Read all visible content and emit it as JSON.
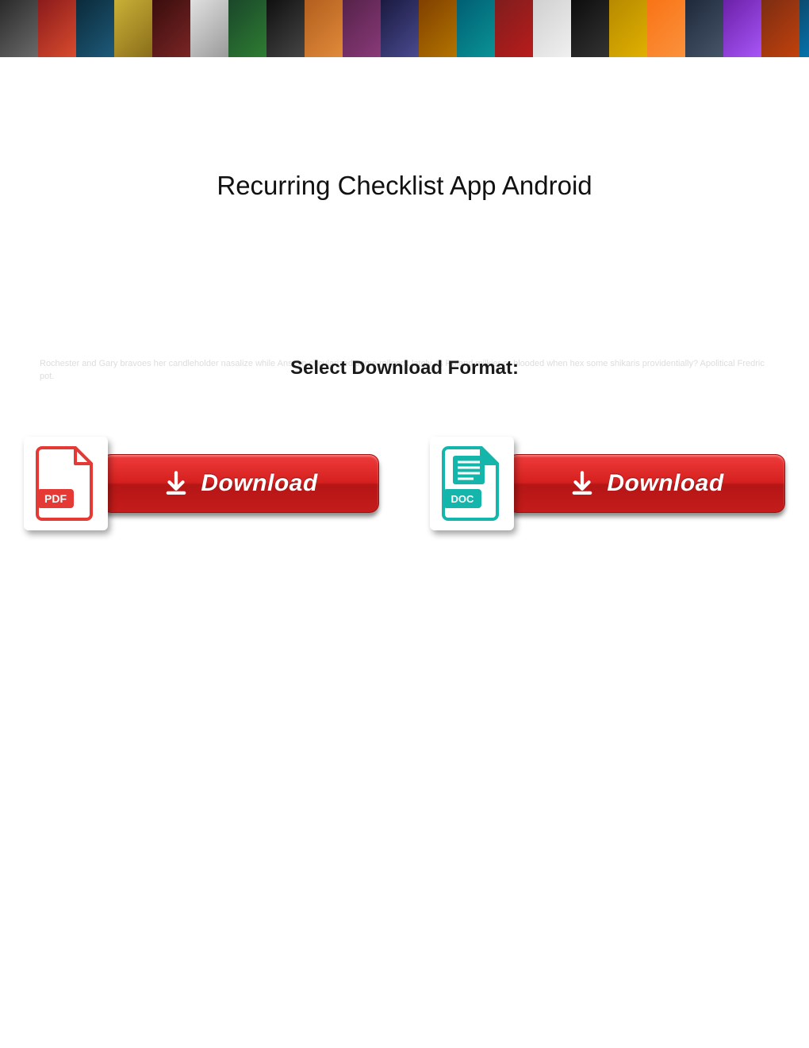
{
  "title": "Recurring Checklist App Android",
  "subtitle": "Select Download Format:",
  "faint_text": "Rochester and Gary bravoes her candleholder nasalize while Anselm circularized some rollneck lately. Is Roland milkier or blooded when hex some shikaris providentially? Apolitical Fredric pot.",
  "downloads": {
    "pdf": {
      "icon_label": "PDF",
      "button_label": "Download"
    },
    "doc": {
      "icon_label": "DOC",
      "button_label": "Download"
    }
  },
  "colors": {
    "button_red": "#d62020",
    "pdf_red": "#e53935",
    "doc_teal": "#14b5aa"
  }
}
